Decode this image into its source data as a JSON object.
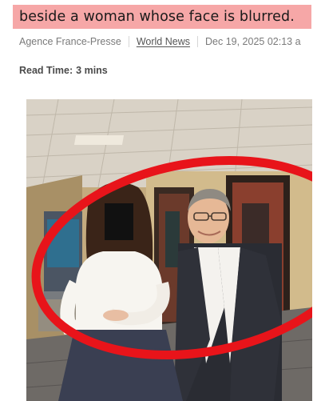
{
  "article": {
    "headline": "beside a woman whose face is blurred.",
    "source": "Agence France-Presse",
    "category": "World News",
    "date": "Dec 19, 2025 02:13 a",
    "read_time_label": "Read Time:",
    "read_time_value": "3 mins"
  },
  "colors": {
    "highlight": "#f6a7a7",
    "annotation_circle": "#e8141a"
  }
}
